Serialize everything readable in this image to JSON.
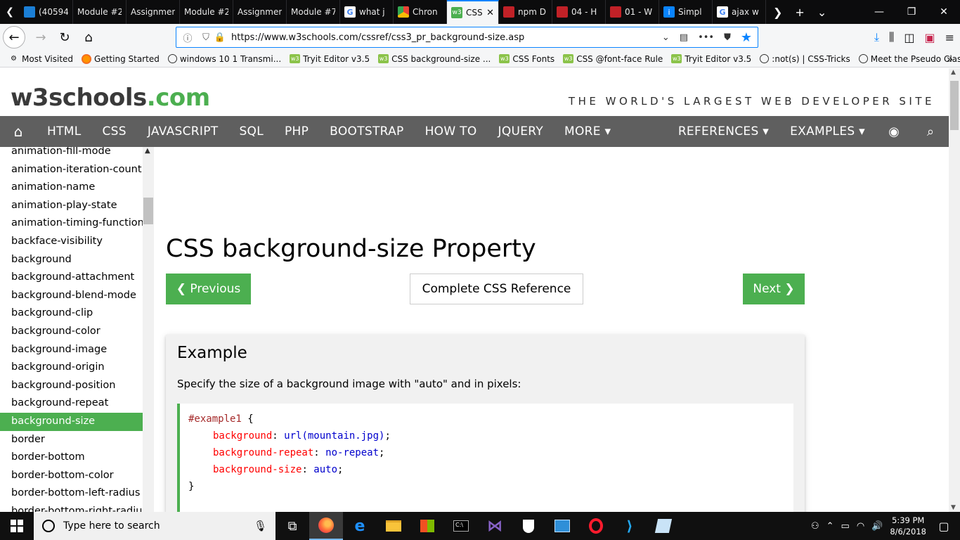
{
  "browser": {
    "tabs": [
      {
        "title": "(40594",
        "icon": "att-icon"
      },
      {
        "title": "Module #2",
        "icon": "none"
      },
      {
        "title": "Assignmen",
        "icon": "none"
      },
      {
        "title": "Module #2",
        "icon": "none"
      },
      {
        "title": "Assignmen",
        "icon": "none"
      },
      {
        "title": "Module #7",
        "icon": "none"
      },
      {
        "title": "what j",
        "icon": "google-icon"
      },
      {
        "title": "Chron",
        "icon": "chrome-icon"
      },
      {
        "title": "CSS",
        "icon": "w3schools-icon",
        "active": true
      },
      {
        "title": "npm D",
        "icon": "npm-icon"
      },
      {
        "title": "04 - H",
        "icon": "npm-icon"
      },
      {
        "title": "01 - W",
        "icon": "npm-icon"
      },
      {
        "title": "Simpl",
        "icon": "info-icon"
      },
      {
        "title": "ajax w",
        "icon": "google-icon"
      }
    ],
    "url": "https://www.w3schools.com/cssref/css3_pr_background-size.asp",
    "bookmarks": [
      {
        "label": "Most Visited",
        "icon": "gear-icon"
      },
      {
        "label": "Getting Started",
        "icon": "firefox-icon"
      },
      {
        "label": "windows 10 1 Transmi...",
        "icon": "globe-icon"
      },
      {
        "label": "Tryit Editor v3.5",
        "icon": "w3schools-icon"
      },
      {
        "label": "CSS background-size ...",
        "icon": "w3schools-icon"
      },
      {
        "label": "CSS Fonts",
        "icon": "w3schools-icon"
      },
      {
        "label": "CSS @font-face Rule",
        "icon": "w3schools-icon"
      },
      {
        "label": "Tryit Editor v3.5",
        "icon": "w3schools-icon"
      },
      {
        "label": ":not(s) | CSS-Tricks",
        "icon": "globe-icon"
      },
      {
        "label": "Meet the Pseudo Class...",
        "icon": "globe-icon"
      }
    ]
  },
  "site": {
    "logo_main": "w3schools",
    "logo_suffix": ".com",
    "tagline": "THE WORLD'S LARGEST WEB DEVELOPER SITE",
    "nav": [
      "HTML",
      "CSS",
      "JAVASCRIPT",
      "SQL",
      "PHP",
      "BOOTSTRAP",
      "HOW TO",
      "JQUERY",
      "MORE ▾"
    ],
    "nav_right": [
      "REFERENCES ▾",
      "EXAMPLES ▾"
    ]
  },
  "sidebar": {
    "items": [
      "animation-fill-mode",
      "animation-iteration-count",
      "animation-name",
      "animation-play-state",
      "animation-timing-function",
      "backface-visibility",
      "background",
      "background-attachment",
      "background-blend-mode",
      "background-clip",
      "background-color",
      "background-image",
      "background-origin",
      "background-position",
      "background-repeat",
      "background-size",
      "border",
      "border-bottom",
      "border-bottom-color",
      "border-bottom-left-radius",
      "border-bottom-right-radius"
    ],
    "active": "background-size"
  },
  "main": {
    "title": "CSS background-size Property",
    "prev_label": "❮ Previous",
    "ref_label": "Complete CSS Reference",
    "next_label": "Next ❯",
    "example_heading": "Example",
    "example_desc": "Specify the size of a background image with \"auto\" and in pixels:",
    "code": {
      "selector": "#example1",
      "open": " {",
      "lines": [
        {
          "prop": "background",
          "value": "url(mountain.jpg)"
        },
        {
          "prop": "background-repeat",
          "value": "no-repeat"
        },
        {
          "prop": "background-size",
          "value": "auto"
        }
      ],
      "close": "}"
    }
  },
  "taskbar": {
    "search_placeholder": "Type here to search",
    "time": "5:39 PM",
    "date": "8/6/2018"
  },
  "colors": {
    "w3_green": "#4caf50",
    "nav_gray": "#5f5f5f",
    "firefox_blue": "#0a84ff"
  }
}
